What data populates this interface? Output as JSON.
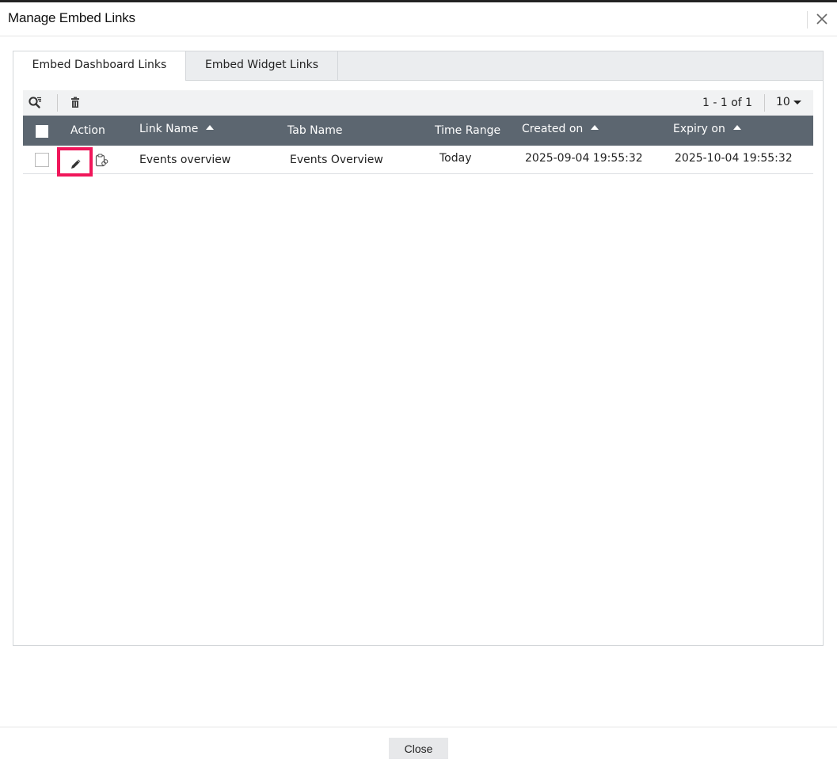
{
  "dialog": {
    "title": "Manage Embed Links"
  },
  "tabs": [
    {
      "label": "Embed Dashboard Links",
      "active": true
    },
    {
      "label": "Embed Widget Links",
      "active": false
    }
  ],
  "toolbar": {
    "search_icon": "search-filter-icon",
    "delete_icon": "trash-icon",
    "pagination": "1 - 1 of 1",
    "per_page": "10"
  },
  "table": {
    "columns": {
      "action": "Action",
      "link_name": "Link Name",
      "tab_name": "Tab Name",
      "time_range": "Time Range",
      "created_on": "Created on",
      "expiry_on": "Expiry on"
    },
    "rows": [
      {
        "link_name": "Events overview",
        "tab_name": "Events Overview",
        "time_range": "Today",
        "created_on": "2025-09-04 19:55:32",
        "expiry_on": "2025-10-04 19:55:32"
      }
    ]
  },
  "footer": {
    "close_label": "Close"
  },
  "colors": {
    "header_bg": "#5c6670",
    "highlight": "#f0165a",
    "tabbar_bg": "#ebedef"
  }
}
